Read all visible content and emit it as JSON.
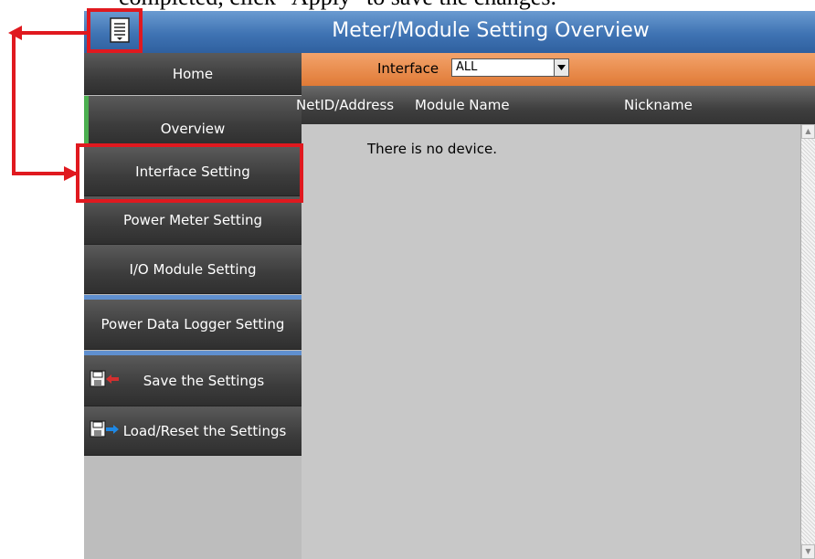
{
  "document": {
    "visible_text": "completed, click \"Apply\" to save the changes."
  },
  "app": {
    "title": "Meter/Module Setting Overview"
  },
  "sidebar": {
    "items": [
      {
        "label": "Home"
      },
      {
        "label": "Overview",
        "active": true
      },
      {
        "label": "Interface Setting"
      },
      {
        "label": "Power Meter Setting"
      },
      {
        "label": "I/O Module Setting"
      },
      {
        "label": "Power Data Logger Setting"
      },
      {
        "label": "Save the Settings",
        "icon": "save-settings-icon"
      },
      {
        "label": "Load/Reset the Settings",
        "icon": "load-settings-icon"
      }
    ]
  },
  "interface_bar": {
    "label": "Interface",
    "selected": "ALL"
  },
  "table": {
    "columns": [
      "NetID/Address",
      "Module Name",
      "Nickname"
    ],
    "empty_message": "There is no device."
  },
  "colors": {
    "titlebar": "#3f73b3",
    "interface_bar": "#e07a36",
    "active_indicator": "#4caf50",
    "annotation": "#e0191f"
  }
}
